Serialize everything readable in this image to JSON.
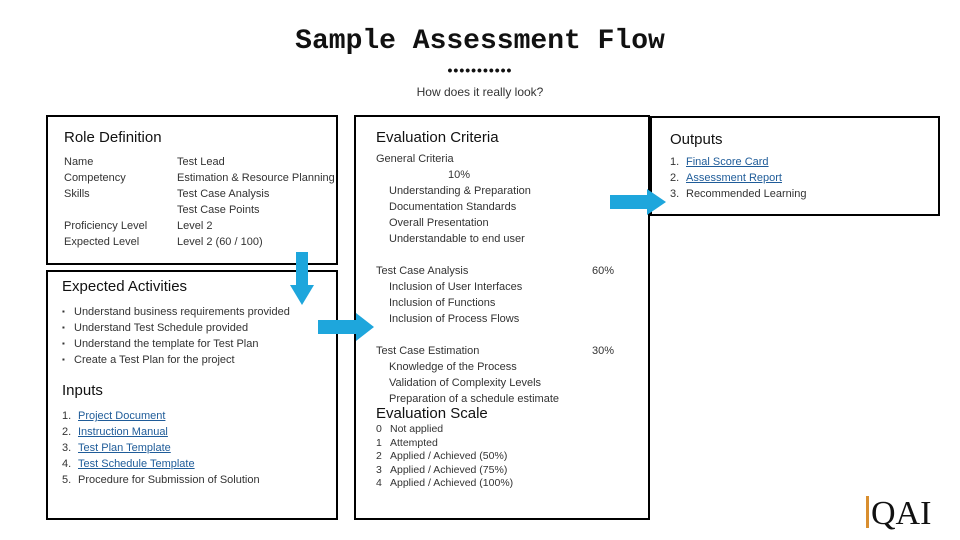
{
  "header": {
    "title": "Sample Assessment Flow",
    "dots": "•••••••••••",
    "subtitle": "How does it really look?"
  },
  "role_definition": {
    "heading": "Role Definition",
    "rows": [
      {
        "label": "Name",
        "value": "Test Lead"
      },
      {
        "label": "Competency",
        "value": "Estimation & Resource Planning"
      },
      {
        "label": "Skills",
        "value": "Test Case Analysis"
      },
      {
        "label": "",
        "value": "Test Case Points"
      },
      {
        "label": "Proficiency Level",
        "value": "Level 2"
      },
      {
        "label": "Expected Level",
        "value": "Level 2  (60 / 100)"
      }
    ]
  },
  "expected_activities": {
    "heading": "Expected Activities",
    "items": [
      "Understand business requirements provided",
      "Understand Test Schedule provided",
      "Understand the template for Test Plan",
      "Create a Test Plan for the project"
    ]
  },
  "inputs": {
    "heading": "Inputs",
    "items": [
      {
        "num": "1.",
        "label": "Project Document",
        "link": true
      },
      {
        "num": "2.",
        "label": "Instruction Manual",
        "link": true
      },
      {
        "num": "3.",
        "label": "Test Plan Template",
        "link": true
      },
      {
        "num": "4.",
        "label": "Test Schedule Template",
        "link": true
      },
      {
        "num": "5.",
        "label": "Procedure for Submission of Solution",
        "link": false
      }
    ]
  },
  "evaluation_criteria": {
    "heading": "Evaluation Criteria",
    "groups": [
      {
        "title": "General Criteria",
        "weight": "10%",
        "items": [
          "Understanding & Preparation",
          "Documentation Standards",
          "Overall Presentation",
          "Understandable to end user"
        ]
      },
      {
        "title": "Test Case Analysis",
        "weight": "60%",
        "items": [
          "Inclusion of User Interfaces",
          "Inclusion of Functions",
          "Inclusion of Process Flows"
        ]
      },
      {
        "title": "Test Case Estimation",
        "weight": "30%",
        "items": [
          "Knowledge of the Process",
          "Validation of Complexity Levels",
          "Preparation of a schedule estimate"
        ]
      }
    ]
  },
  "evaluation_scale": {
    "heading": "Evaluation Scale",
    "items": [
      {
        "score": "0",
        "label": "Not applied"
      },
      {
        "score": "1",
        "label": "Attempted"
      },
      {
        "score": "2",
        "label": "Applied / Achieved (50%)"
      },
      {
        "score": "3",
        "label": "Applied / Achieved (75%)"
      },
      {
        "score": "4",
        "label": "Applied / Achieved (100%)"
      }
    ]
  },
  "outputs": {
    "heading": "Outputs",
    "items": [
      {
        "num": "1.",
        "label": "Final Score Card",
        "link": true
      },
      {
        "num": "2.",
        "label": "Assessment Report",
        "link": true
      },
      {
        "num": "3.",
        "label": "Recommended Learning",
        "link": false
      }
    ]
  },
  "logo": {
    "text": "QAI"
  },
  "colors": {
    "arrow": "#1ea6dc",
    "link": "#1f5c99",
    "logo_bar": "#d98e2f"
  }
}
